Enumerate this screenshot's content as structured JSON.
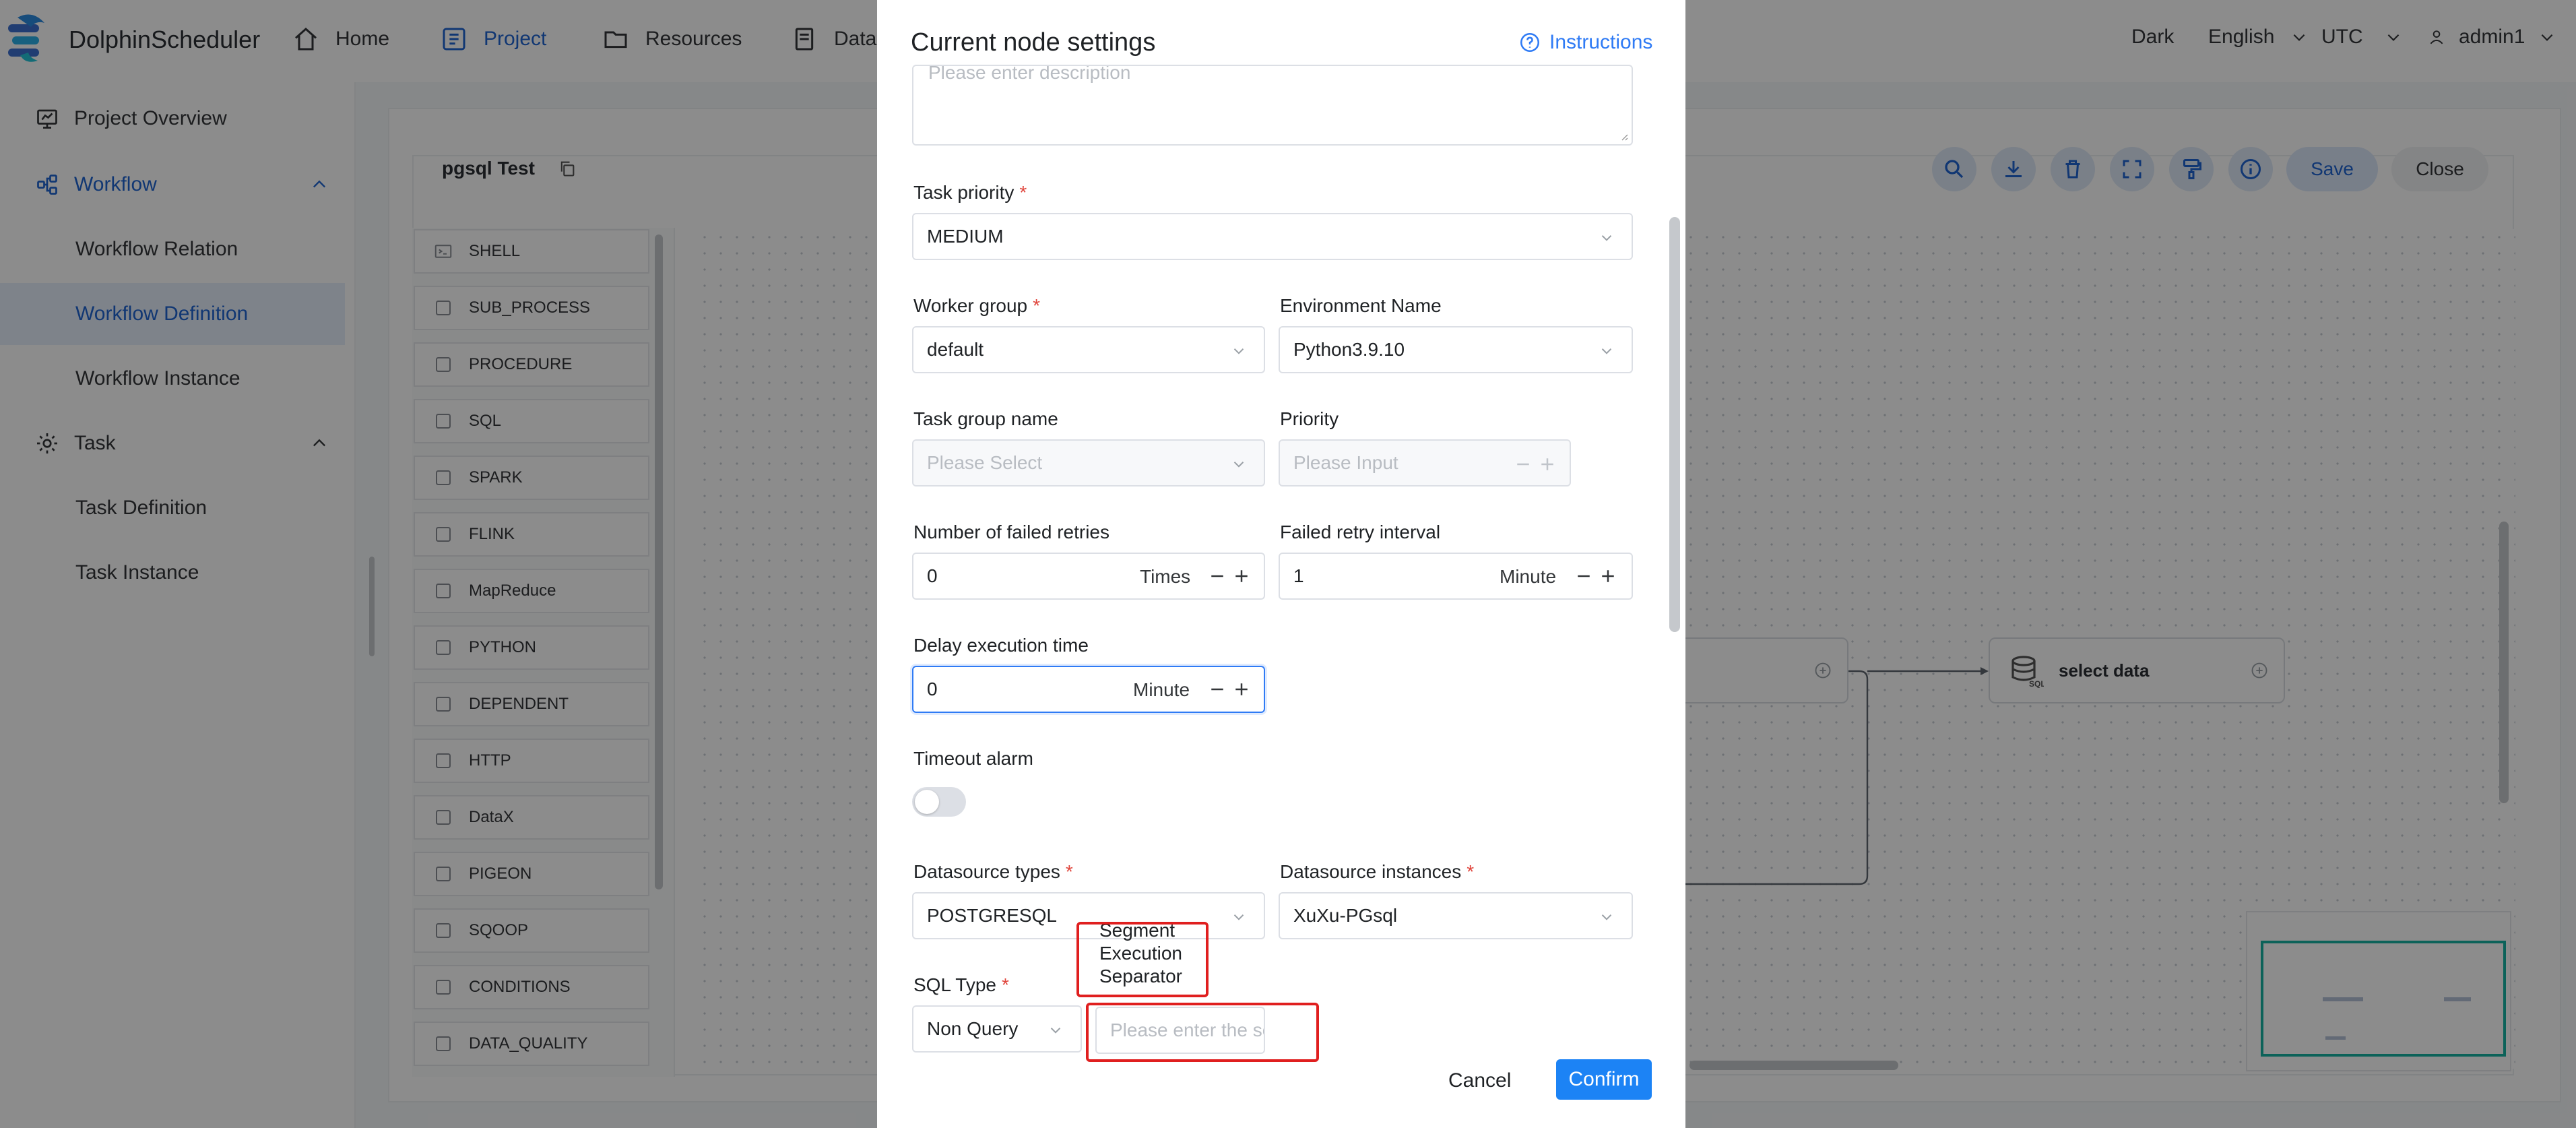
{
  "header": {
    "logo_text": "DolphinScheduler",
    "nav": [
      {
        "label": "Home",
        "icon": "home-icon"
      },
      {
        "label": "Project",
        "icon": "project-icon",
        "active": true
      },
      {
        "label": "Resources",
        "icon": "folder-icon"
      },
      {
        "label": "Data Q",
        "icon": "document-icon"
      }
    ],
    "theme": "Dark",
    "language": "English",
    "timezone": "UTC",
    "user": "admin1"
  },
  "sidebar": {
    "items": [
      {
        "label": "Project Overview",
        "icon": "monitor-icon"
      },
      {
        "label": "Workflow",
        "icon": "workflow-icon",
        "expanded": true
      },
      {
        "label": "Workflow Relation"
      },
      {
        "label": "Workflow Definition",
        "selected": true
      },
      {
        "label": "Workflow Instance"
      },
      {
        "label": "Task",
        "icon": "gear-icon",
        "expanded": true
      },
      {
        "label": "Task Definition"
      },
      {
        "label": "Task Instance"
      }
    ]
  },
  "canvas": {
    "title": "pgsql Test",
    "save_label": "Save",
    "close_label": "Close",
    "task_types": [
      "SHELL",
      "SUB_PROCESS",
      "PROCEDURE",
      "SQL",
      "SPARK",
      "FLINK",
      "MapReduce",
      "PYTHON",
      "DEPENDENT",
      "HTTP",
      "DataX",
      "PIGEON",
      "SQOOP",
      "CONDITIONS",
      "DATA_QUALITY"
    ],
    "node_label": "select data",
    "node_badge": "SQL"
  },
  "modal": {
    "title": "Current node settings",
    "instructions": "Instructions",
    "description_placeholder": "Please enter description",
    "task_priority": {
      "label": "Task priority",
      "value": "MEDIUM"
    },
    "worker_group": {
      "label": "Worker group",
      "value": "default"
    },
    "environment_name": {
      "label": "Environment Name",
      "value": "Python3.9.10"
    },
    "task_group_name": {
      "label": "Task group name",
      "placeholder": "Please Select"
    },
    "priority": {
      "label": "Priority",
      "placeholder": "Please Input"
    },
    "failed_retries": {
      "label": "Number of failed retries",
      "value": "0",
      "unit": "Times"
    },
    "retry_interval": {
      "label": "Failed retry interval",
      "value": "1",
      "unit": "Minute"
    },
    "delay_execution": {
      "label": "Delay execution time",
      "value": "0",
      "unit": "Minute"
    },
    "timeout_alarm": {
      "label": "Timeout alarm",
      "on": false
    },
    "datasource_types": {
      "label": "Datasource types",
      "value": "POSTGRESQL"
    },
    "datasource_instances": {
      "label": "Datasource instances",
      "value": "XuXu-PGsql"
    },
    "segment_separator_label": [
      "Segment",
      "Execution",
      "Separator"
    ],
    "sql_type": {
      "label": "SQL Type",
      "value": "Non Query"
    },
    "separator_placeholder": "Please enter the segment execution separator",
    "cancel_label": "Cancel",
    "confirm_label": "Confirm"
  },
  "colors": {
    "primary": "#1c83f5",
    "accent_blue": "#1f64d1",
    "required": "#e0453c",
    "highlight_box": "#e01f1f",
    "minimap_viewport": "#17b3a3"
  }
}
